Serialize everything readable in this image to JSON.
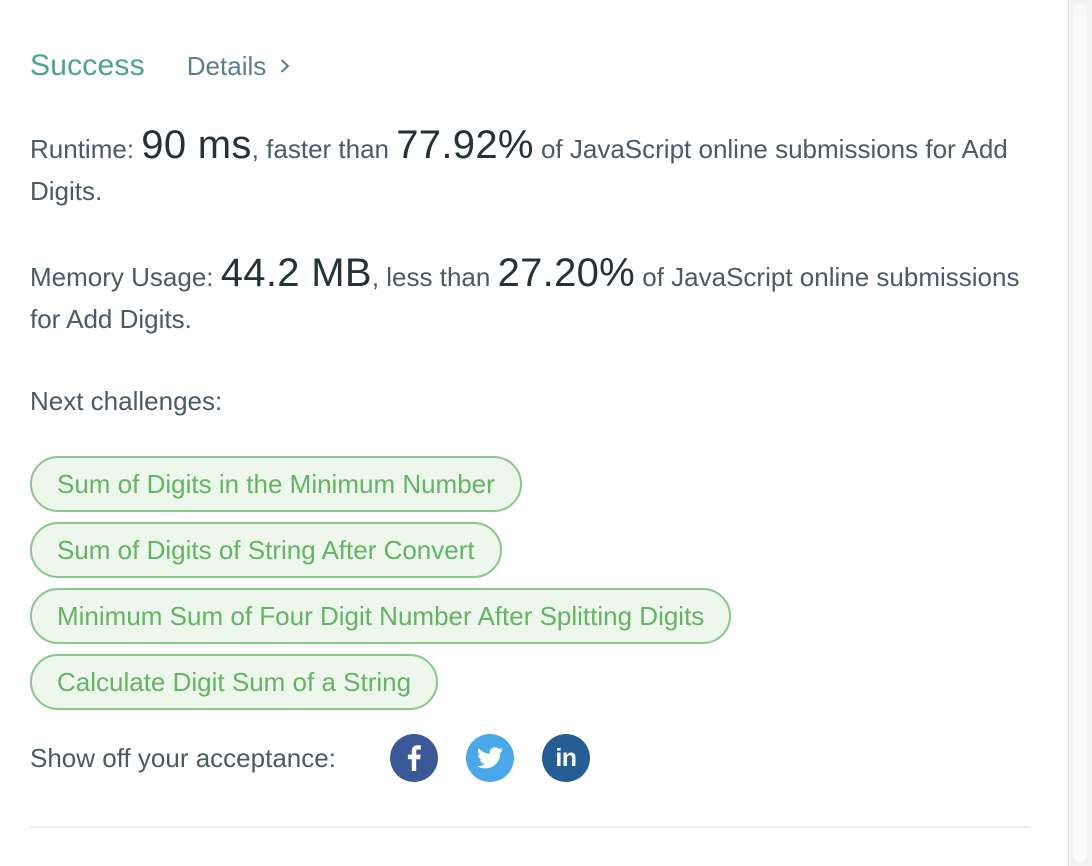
{
  "result": {
    "status": "Success",
    "details_label": "Details",
    "status_color": "#4ca297"
  },
  "runtime": {
    "label": "Runtime:",
    "value": "90 ms",
    "comparison": ", faster than",
    "percent": "77.92%",
    "suffix": "of JavaScript online submissions for Add Digits."
  },
  "memory": {
    "label": "Memory Usage:",
    "value": "44.2 MB",
    "comparison": ", less than",
    "percent": "27.20%",
    "suffix": "of JavaScript online submissions for Add Digits."
  },
  "next_challenges": {
    "label": "Next challenges:",
    "items": [
      "Sum of Digits in the Minimum Number",
      "Sum of Digits of String After Convert",
      "Minimum Sum of Four Digit Number After Splitting Digits",
      "Calculate Digit Sum of a String"
    ]
  },
  "share": {
    "label": "Show off your acceptance:",
    "linkedin_text": "in",
    "icons": [
      "facebook-icon",
      "twitter-icon",
      "linkedin-icon"
    ],
    "colors": {
      "facebook": "#3b5998",
      "twitter": "#4aa8e8",
      "linkedin": "#245e94"
    }
  }
}
